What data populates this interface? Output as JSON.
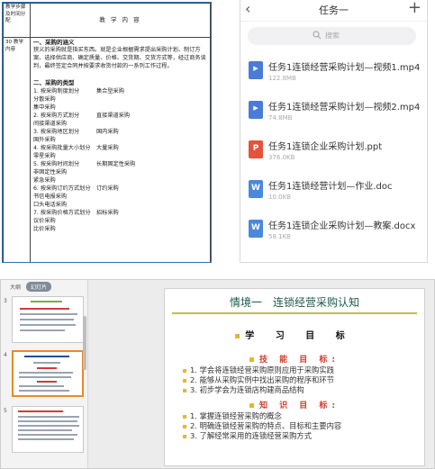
{
  "document": {
    "header_left": "教学步骤及时间分配",
    "header_right": "教 学 内 容",
    "body_left": "30 教学内容",
    "section1_title": "一、采购的涵义",
    "section1_text": "狭义的采购就是指买东西。就是企业根据需求提出采购计划、制订方案、选择供应商、确定质量、价格、交货期、交货方式等，经过商务谈判，最终签定合同并按要求收货付款的一系列工作过程。",
    "section2_title": "二、采购的类型",
    "types": [
      {
        "left": "1. 按采购制度划分",
        "right": "集合型采购"
      },
      {
        "left": "分散采购",
        "right": ""
      },
      {
        "left": "集中采购",
        "right": ""
      },
      {
        "left": "2. 按采购方式划分",
        "right": "直接渠道采购"
      },
      {
        "left": "间接渠道采购",
        "right": ""
      },
      {
        "left": "3. 按采购地区划分",
        "right": "国内采购"
      },
      {
        "left": "国外采购",
        "right": ""
      },
      {
        "left": "4. 按采购批量大小划分",
        "right": "大量采购"
      },
      {
        "left": "零星采购",
        "right": ""
      },
      {
        "left": "5. 按采购时间划分",
        "right": "长期固定性采购"
      },
      {
        "left": "非固定性采购",
        "right": ""
      },
      {
        "left": "紧急采购",
        "right": ""
      },
      {
        "left": "6. 按采购订约方式划分",
        "right": "订约采购"
      },
      {
        "left": "书信电报采购",
        "right": ""
      },
      {
        "left": "口头电话采购",
        "right": ""
      },
      {
        "left": "7. 按采购价格方式划分",
        "right": "招标采购"
      },
      {
        "left": "议价采购",
        "right": ""
      },
      {
        "left": "比价采购",
        "right": ""
      }
    ]
  },
  "phone": {
    "title": "任务一",
    "back_icon": "chevron-left-icon",
    "add_icon": "plus-icon",
    "search_placeholder": "搜索",
    "files": [
      {
        "name": "任务1连锁经营采购计划—视频1.mp4",
        "size": "122.8MB",
        "type": "video",
        "color": "#4a7bd8"
      },
      {
        "name": "任务1连锁经营采购计划—视频2.mp4",
        "size": "74.8MB",
        "type": "video",
        "color": "#4a7bd8"
      },
      {
        "name": "任务1连锁企业采购计划.ppt",
        "size": "376.0KB",
        "type": "ppt",
        "color": "#e4533b"
      },
      {
        "name": "任务1连锁经营计划—作业.doc",
        "size": "10.0KB",
        "type": "doc",
        "color": "#4a88e0"
      },
      {
        "name": "任务1连锁企业采购计划—教案.docx",
        "size": "58.1KB",
        "type": "doc",
        "color": "#4a88e0"
      }
    ]
  },
  "editor": {
    "tab_outline": "大纲",
    "tab_slides": "幻灯片",
    "thumbnails": [
      {
        "number": "3"
      },
      {
        "number": "4"
      },
      {
        "number": "5"
      }
    ],
    "slide": {
      "title": "情境一　连锁经营采购认知",
      "subtitle": "学 习 目 标",
      "skill_heading": "技 能 目 标:",
      "skill_items": [
        {
          "n": "1.",
          "text": "学会将连锁经营采购原则应用于采购实践"
        },
        {
          "n": "2.",
          "text": "能够从采购实例中找出采购的程序和环节"
        },
        {
          "n": "3.",
          "text": "初步学会为连锁店构建商品结构"
        }
      ],
      "knowledge_heading": "知 识 目 标:",
      "knowledge_items": [
        {
          "n": "1.",
          "text": "掌握连锁经营采购的概念"
        },
        {
          "n": "2.",
          "text": "明确连锁经营采购的特点、目标和主要内容"
        },
        {
          "n": "3.",
          "text": "了解经常采用的连锁经营采购方式"
        }
      ]
    }
  }
}
